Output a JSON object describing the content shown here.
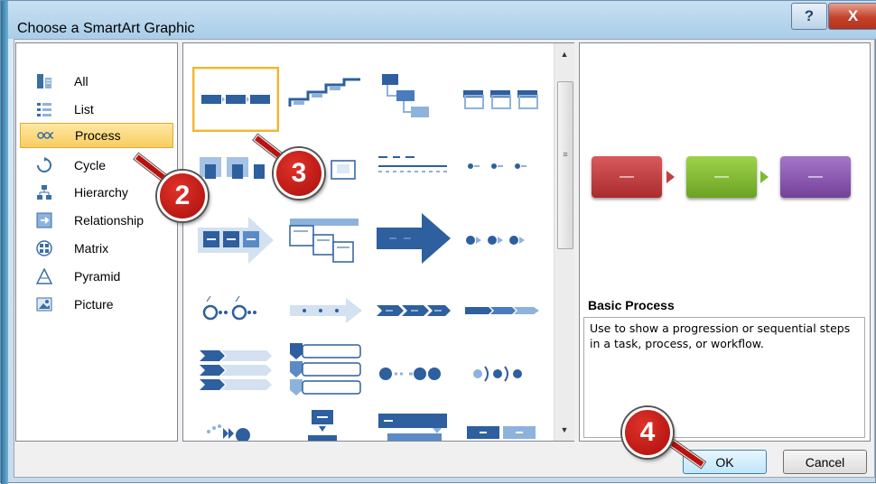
{
  "window": {
    "title": "Choose a SmartArt Graphic",
    "help_label": "?",
    "close_label": "X"
  },
  "categories": [
    {
      "label": "All",
      "icon": "all-icon",
      "selected": false
    },
    {
      "label": "List",
      "icon": "list-icon",
      "selected": false
    },
    {
      "label": "Process",
      "icon": "process-icon",
      "selected": true
    },
    {
      "label": "Cycle",
      "icon": "cycle-icon",
      "selected": false
    },
    {
      "label": "Hierarchy",
      "icon": "hierarchy-icon",
      "selected": false
    },
    {
      "label": "Relationship",
      "icon": "relationship-icon",
      "selected": false
    },
    {
      "label": "Matrix",
      "icon": "matrix-icon",
      "selected": false
    },
    {
      "label": "Pyramid",
      "icon": "pyramid-icon",
      "selected": false
    },
    {
      "label": "Picture",
      "icon": "picture-icon",
      "selected": false
    }
  ],
  "gallery": {
    "selected_index": 0,
    "layouts": [
      "basic-process",
      "step-up-process",
      "step-down-process",
      "accent-process",
      "alternating-flow",
      "continuous-block-process",
      "increasing-arrows-process",
      "process-arrows",
      "continuous-arrow-process",
      "process-arrows-2",
      "upward-arrow",
      "circle-accent-timeline",
      "basic-timeline",
      "basic-chevron-process",
      "closed-chevron-process",
      "chevron-list",
      "vertical-chevron-list",
      "sub-step-process",
      "phased-process",
      "equation",
      "segmented-process",
      "funnel",
      "gear",
      "arrow-ribbon"
    ]
  },
  "preview": {
    "boxes": [
      {
        "label": "—",
        "color": "#c0393b"
      },
      {
        "label": "—",
        "color": "#7fbb2f"
      },
      {
        "label": "—",
        "color": "#8a53b0"
      }
    ],
    "arrow_colors": [
      "#c0393b",
      "#7fbb2f"
    ],
    "title": "Basic Process",
    "description": "Use to show a progression or sequential steps in a task, process, or workflow."
  },
  "buttons": {
    "ok": "OK",
    "cancel": "Cancel"
  },
  "callouts": [
    "2",
    "3",
    "4"
  ],
  "colors": {
    "accent_blue": "#2f5f9a",
    "selection": "#f8cd5f",
    "callout_red": "#c41a16"
  }
}
